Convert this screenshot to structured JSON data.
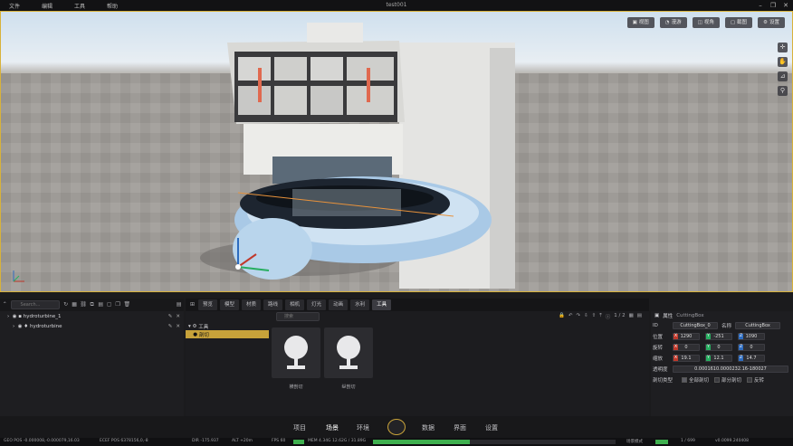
{
  "window": {
    "title": "test001"
  },
  "menu": [
    "文件",
    "编辑",
    "工具",
    "帮助"
  ],
  "viewport_toolbar": [
    "视图",
    "漫游",
    "视角",
    "截图",
    "设置"
  ],
  "viewport_side_icons": [
    "move-icon",
    "hand-icon",
    "ruler-icon",
    "pin-icon"
  ],
  "scene_tree": {
    "search_placeholder": "Search...",
    "items": [
      {
        "label": "hydroturbine_1",
        "depth": 0
      },
      {
        "label": "hydroturbine",
        "depth": 1
      }
    ]
  },
  "tabs": [
    {
      "label": "预览",
      "active": false
    },
    {
      "label": "模型",
      "active": false
    },
    {
      "label": "材质",
      "active": false
    },
    {
      "label": "路线",
      "active": false
    },
    {
      "label": "相机",
      "active": false
    },
    {
      "label": "灯光",
      "active": false
    },
    {
      "label": "动画",
      "active": false
    },
    {
      "label": "水利",
      "active": false
    },
    {
      "label": "工具",
      "active": true
    }
  ],
  "asset_browser": {
    "search_placeholder": "搜索",
    "page": "1 / 2",
    "folders": [
      {
        "label": "工具",
        "selected": false
      },
      {
        "label": "剖切",
        "selected": true
      }
    ],
    "assets": [
      {
        "label": "横剖切"
      },
      {
        "label": "纵剖切"
      }
    ]
  },
  "properties": {
    "header": "属性",
    "header_value": "CuttingBox",
    "id_label": "ID",
    "id_value": "CuttingBox_0",
    "name_label": "名称",
    "name_value": "CuttingBox",
    "position_label": "位置",
    "position": [
      "1290",
      "-251",
      "1090"
    ],
    "rotation_label": "旋转",
    "rotation": [
      "0",
      "0",
      "0"
    ],
    "scale_label": "缩放",
    "scale": [
      "19.1",
      "12.1",
      "14.7"
    ],
    "transparency_label": "透明度",
    "transparency_value": "0.0001610.0000232.16-180027",
    "cut_type_label": "剖切类型",
    "cut_options": [
      {
        "label": "全部剖切",
        "checked": true
      },
      {
        "label": "部分剖切",
        "checked": false
      },
      {
        "label": "反转",
        "checked": false
      }
    ]
  },
  "bottom_nav": [
    {
      "label": "项目",
      "active": false
    },
    {
      "label": "场景",
      "active": true
    },
    {
      "label": "环境",
      "active": false
    },
    {
      "label": "数据",
      "active": false
    },
    {
      "label": "界面",
      "active": false
    },
    {
      "label": "设置",
      "active": false
    }
  ],
  "status": {
    "geo_pos": "GEO POS  -0.000008,-0.000079,16.03",
    "ecef_pos": "ECEF POS  6378156,0,-8",
    "dir": "DIR  -175.937",
    "alt": "ALT  +20m",
    "fps": "FPS  60",
    "mem": "MEM  4.34G  12.62G / 31.89G",
    "mem_fraction": 0.4,
    "mode": "场景模式",
    "count": "1 / 699",
    "version": "v0.0099.240408",
    "colors": {
      "accent": "#c7a23a",
      "ok": "#3fb04f"
    }
  }
}
